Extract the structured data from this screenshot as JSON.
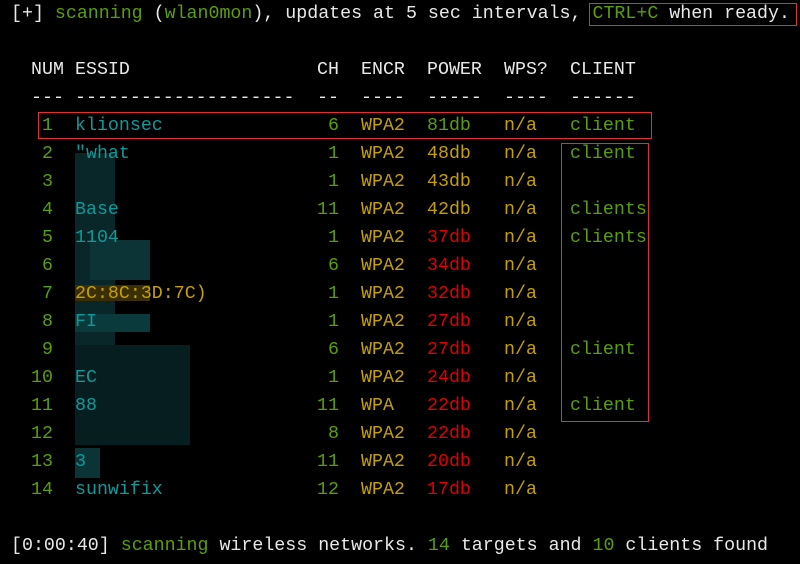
{
  "status_top": {
    "prefix": "[+] ",
    "scanning": "scanning",
    "open": " (",
    "iface": "wlan0mon",
    "middle": "), updates at 5 sec intervals, ",
    "ctrl": "CTRL+C",
    "end": " when ready."
  },
  "table": {
    "headers": {
      "num": "NUM",
      "essid": "ESSID",
      "ch": "CH",
      "encr": "ENCR",
      "power": "POWER",
      "wps": "WPS?",
      "client": "CLIENT"
    },
    "dashes": {
      "num": "---",
      "essid": "--------------------",
      "ch": "--",
      "encr": "----",
      "power": "-----",
      "wps": "----",
      "client": "------"
    },
    "rows": [
      {
        "num": "1",
        "essid": "klionsec",
        "ch": "6",
        "encr": "WPA2",
        "power": "81db",
        "wps": "n/a",
        "client": "client",
        "power_color": "#5a9e0a"
      },
      {
        "num": "2",
        "essid": "\"what",
        "ch": "1",
        "encr": "WPA2",
        "power": "48db",
        "wps": "n/a",
        "client": "client",
        "power_color": "#c4a000"
      },
      {
        "num": "3",
        "essid": "",
        "ch": "1",
        "encr": "WPA2",
        "power": "43db",
        "wps": "n/a",
        "client": "",
        "power_color": "#c4a000"
      },
      {
        "num": "4",
        "essid": "Base",
        "ch": "11",
        "encr": "WPA2",
        "power": "42db",
        "wps": "n/a",
        "client": "clients",
        "power_color": "#c4a000"
      },
      {
        "num": "5",
        "essid": "1104",
        "ch": "1",
        "encr": "WPA2",
        "power": "37db",
        "wps": "n/a",
        "client": "clients",
        "power_color": "#e00000"
      },
      {
        "num": "6",
        "essid": "",
        "ch": "6",
        "encr": "WPA2",
        "power": "34db",
        "wps": "n/a",
        "client": "",
        "power_color": "#e00000"
      },
      {
        "num": "7",
        "essid": "2C:8C:3D:7C)",
        "essid_color": "#c4a000",
        "ch": "1",
        "encr": "WPA2",
        "power": "32db",
        "wps": "n/a",
        "client": "",
        "power_color": "#e00000"
      },
      {
        "num": "8",
        "essid": "FI",
        "ch": "1",
        "encr": "WPA2",
        "power": "27db",
        "wps": "n/a",
        "client": "",
        "power_color": "#e00000"
      },
      {
        "num": "9",
        "essid": "",
        "ch": "6",
        "encr": "WPA2",
        "power": "27db",
        "wps": "n/a",
        "client": "client",
        "power_color": "#e00000"
      },
      {
        "num": "10",
        "essid": "EC",
        "ch": "1",
        "encr": "WPA2",
        "power": "24db",
        "wps": "n/a",
        "client": "",
        "power_color": "#e00000"
      },
      {
        "num": "11",
        "essid": "88",
        "ch": "11",
        "encr": "WPA",
        "power": "22db",
        "wps": "n/a",
        "client": "client",
        "power_color": "#e00000"
      },
      {
        "num": "12",
        "essid": "",
        "ch": "8",
        "encr": "WPA2",
        "power": "22db",
        "wps": "n/a",
        "client": "",
        "power_color": "#e00000"
      },
      {
        "num": "13",
        "essid": "3",
        "ch": "11",
        "encr": "WPA2",
        "power": "20db",
        "wps": "n/a",
        "client": "",
        "power_color": "#e00000"
      },
      {
        "num": "14",
        "essid": "sunwifix",
        "ch": "12",
        "encr": "WPA2",
        "power": "17db",
        "wps": "n/a",
        "client": "",
        "power_color": "#e00000"
      }
    ]
  },
  "status_bottom": {
    "time": "[0:00:40] ",
    "scanning": "scanning",
    "mid": " wireless networks. ",
    "targets": "14",
    "and": " targets and ",
    "clients": "10",
    "end": " clients found"
  }
}
